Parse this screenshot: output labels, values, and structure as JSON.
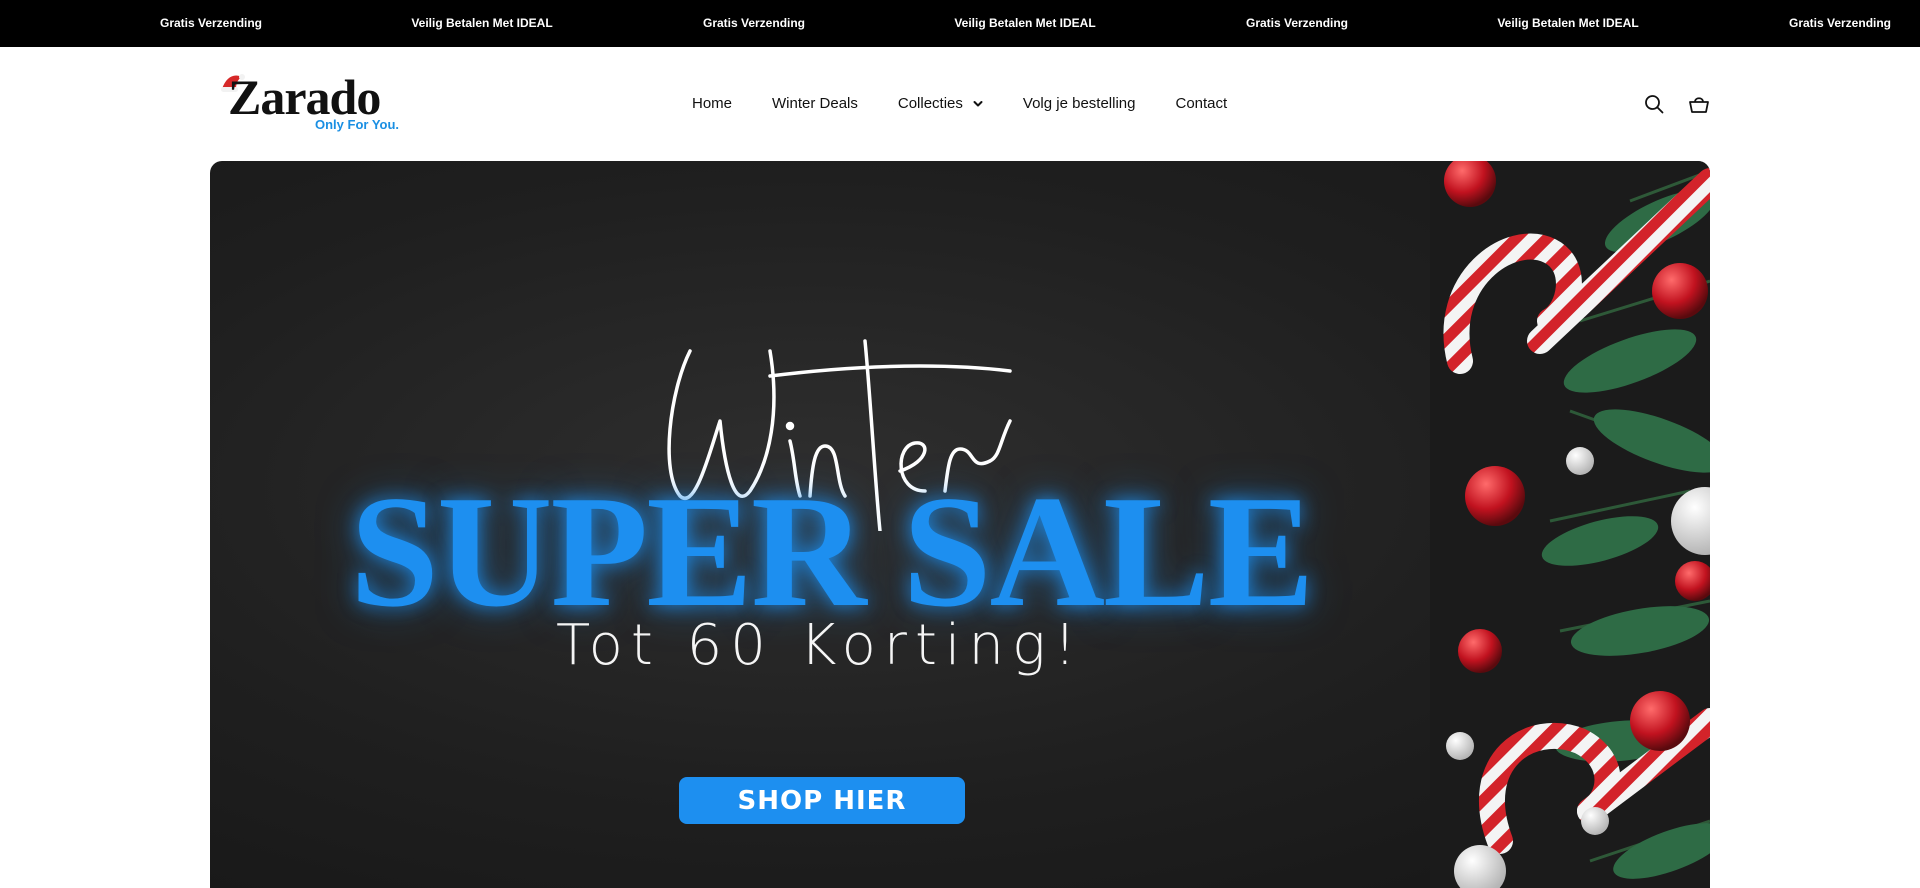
{
  "announcement_bar": {
    "items": [
      "Gratis Verzending",
      "Veilig Betalen Met IDEAL",
      "Gratis Verzending",
      "Veilig Betalen Met IDEAL",
      "Gratis Verzending",
      "Veilig Betalen Met IDEAL",
      "Gratis Verzending"
    ],
    "background": "#000000",
    "text_color": "#ffffff"
  },
  "header": {
    "logo": {
      "wordmark": "Zarado",
      "tagline": "Only For You.",
      "tagline_color": "#1a8fe3",
      "hat_icon": "santa-hat-icon"
    },
    "nav": [
      {
        "label": "Home"
      },
      {
        "label": "Winter Deals"
      },
      {
        "label": "Collecties",
        "has_dropdown": true
      },
      {
        "label": "Volg je bestelling"
      },
      {
        "label": "Contact"
      }
    ],
    "icons": [
      "search-icon",
      "cart-icon"
    ]
  },
  "hero": {
    "script_word": "Winter",
    "headline": "SUPER SALE",
    "subheadline": "Tot 60 Korting!",
    "cta_label": "SHOP HIER",
    "accent_color": "#1d8ff0",
    "background_color": "#1f1f1f"
  }
}
